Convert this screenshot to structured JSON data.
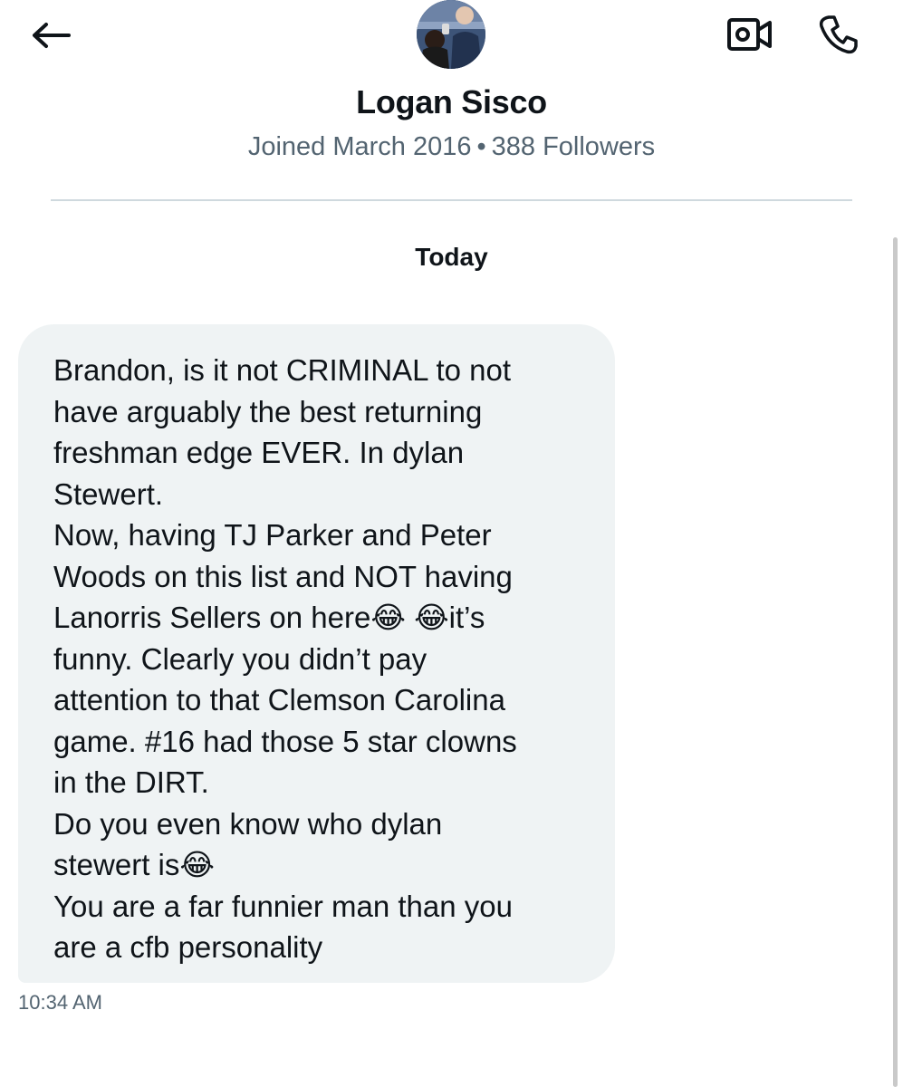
{
  "header": {
    "back_icon": "arrow-left-icon",
    "avatar_icon": "profile-photo",
    "video_call_icon": "video-camera-icon",
    "phone_call_icon": "phone-icon"
  },
  "profile": {
    "name": "Logan Sisco",
    "joined": "Joined March 2016",
    "separator": "•",
    "followers": "388 Followers"
  },
  "conversation": {
    "day_label": "Today",
    "messages": [
      {
        "lines": [
          "Brandon, is it not CRIMINAL to not",
          "have arguably the best returning",
          "freshman edge EVER. In dylan",
          "Stewert.",
          "Now, having TJ Parker and Peter",
          "Woods on this list and NOT having",
          "Lanorris Sellers on here😂 😂it’s",
          "funny. Clearly you didn’t pay",
          "attention to that Clemson Carolina",
          "game. #16 had those 5 star clowns",
          "in the DIRT.",
          "Do you even know who dylan",
          "stewert is😂",
          "You are a far funnier man than you",
          "are a cfb personality"
        ],
        "time": "10:34 AM"
      }
    ]
  },
  "colors": {
    "text_primary": "#0f1419",
    "text_secondary": "#536471",
    "bubble_background": "#eff3f4",
    "divider": "#cfd9de"
  }
}
